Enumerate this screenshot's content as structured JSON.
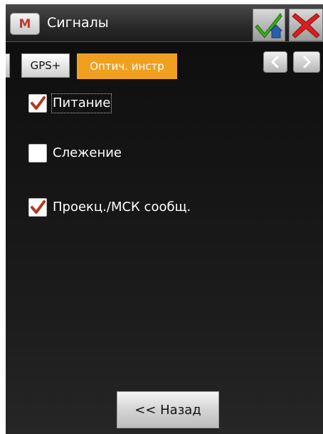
{
  "window": {
    "title": "Сигналы",
    "app_icon_letter": "M"
  },
  "titlebar_buttons": {
    "ok_icon": "check-house-icon",
    "cancel_icon": "red-x-icon"
  },
  "tabs": [
    {
      "label": "GPS+",
      "active": false
    },
    {
      "label": "Оптич. инстр",
      "active": true
    }
  ],
  "tab_nav": {
    "prev_icon": "chevron-left-icon",
    "next_icon": "chevron-right-icon"
  },
  "options": [
    {
      "label": "Питание",
      "checked": true
    },
    {
      "label": "Слежение",
      "checked": false
    },
    {
      "label": "Проекц./МСК сообщ.",
      "checked": true
    }
  ],
  "footer": {
    "back_label": "<< Назад"
  },
  "colors": {
    "active_tab": "#f0a020",
    "check_mark": "#b3361e",
    "ok_check": "#3caa1e",
    "cancel_x": "#d62020"
  }
}
